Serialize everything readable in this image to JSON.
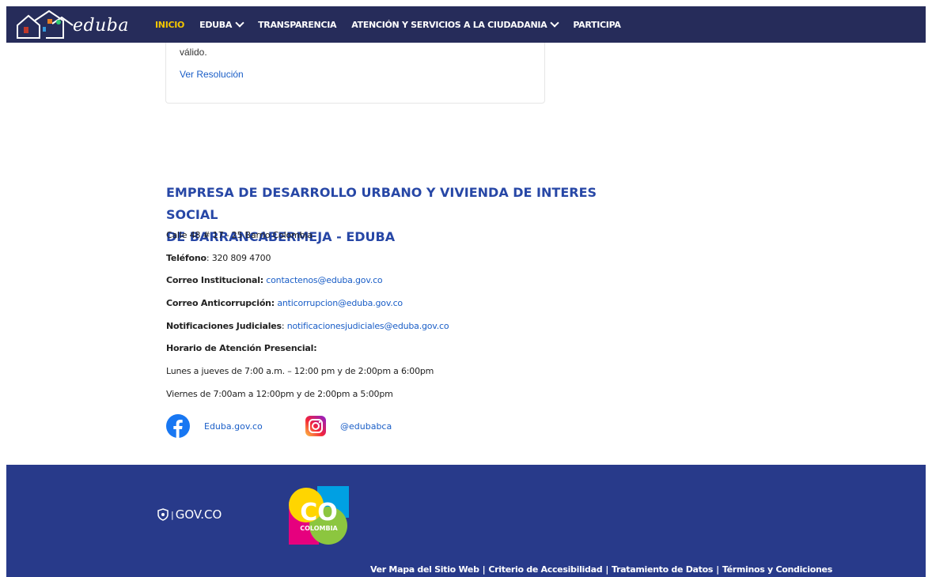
{
  "nav": {
    "logo_text": "eduba",
    "items": [
      {
        "label": "INICIO",
        "active": true,
        "dropdown": false
      },
      {
        "label": "EDUBA",
        "active": false,
        "dropdown": true
      },
      {
        "label": "TRANSPARENCIA",
        "active": false,
        "dropdown": false
      },
      {
        "label": "ATENCIÓN Y SERVICIOS A LA CIUDADANIA",
        "active": false,
        "dropdown": true
      },
      {
        "label": "PARTICIPA",
        "active": false,
        "dropdown": false
      }
    ]
  },
  "card": {
    "text": "válido.",
    "link": "Ver Resolución"
  },
  "contact": {
    "title_line1": "EMPRESA DE DESARROLLO URBANO Y VIVIENDA DE INTERES SOCIAL",
    "title_line2": "DE BARRANCABERMEJA - EDUBA",
    "address": "Calle 48 # 17 - 25 Barrio Colombia",
    "phone_label": "Teléfono",
    "phone": "320 809 4700",
    "email_inst_label": "Correo Institucional:",
    "email_inst": "contactenos@eduba.gov.co",
    "email_anti_label": "Correo Anticorrupción:",
    "email_anti": "anticorrupcion@eduba.gov.co",
    "notif_label": "Notificaciones Judiciales",
    "notif": "notificacionesjudiciales@eduba.gov.co",
    "hours_label": "Horario de Atención Presencial:",
    "hours_1": "Lunes a jueves de 7:00 a.m. – 12:00 pm y de 2:00pm a 6:00pm",
    "hours_2": "Viernes de 7:00am a 12:00pm y de 2:00pm a 5:00pm"
  },
  "social": {
    "facebook": "Eduba.gov.co",
    "instagram": "@edubabca"
  },
  "footer": {
    "govco": "GOV.CO",
    "co_logo_top": "CO",
    "co_logo_bottom": "COLOMBIA",
    "links": [
      "Ver Mapa del Sitio Web",
      "Criterio de Accesibilidad",
      "Tratamiento de Datos",
      "Términos y Condiciones"
    ]
  },
  "colors": {
    "nav_bg": "#262c5a",
    "active": "#f2c500",
    "title": "#2747a6",
    "link": "#1a5ec7",
    "footer_bg": "#283a8a"
  }
}
